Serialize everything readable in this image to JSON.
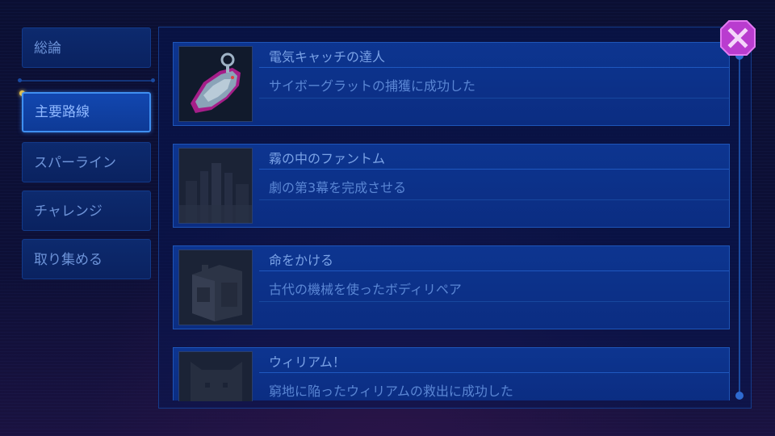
{
  "sidebar": {
    "items": [
      {
        "label": "総論",
        "active": false
      },
      {
        "label": "主要路線",
        "active": true
      },
      {
        "label": "スパーライン",
        "active": false
      },
      {
        "label": "チャレンジ",
        "active": false
      },
      {
        "label": "取り集める",
        "active": false
      }
    ]
  },
  "achievements": [
    {
      "title": "電気キャッチの達人",
      "description": "サイボーグラットの捕獲に成功した",
      "icon": "cyborg-rat-icon",
      "unlocked": true
    },
    {
      "title": "霧の中のファントム",
      "description": "劇の第3幕を完成させる",
      "icon": "foggy-city-icon",
      "unlocked": false
    },
    {
      "title": "命をかける",
      "description": "古代の機械を使ったボディリペア",
      "icon": "ancient-machine-icon",
      "unlocked": false
    },
    {
      "title": "ウィリアム！",
      "description": "窮地に陥ったウィリアムの救出に成功した",
      "icon": "cat-william-icon",
      "unlocked": false
    }
  ],
  "colors": {
    "accent": "#3f8ff0",
    "close": "#c43fd6",
    "highlight": "#f2c53c"
  }
}
